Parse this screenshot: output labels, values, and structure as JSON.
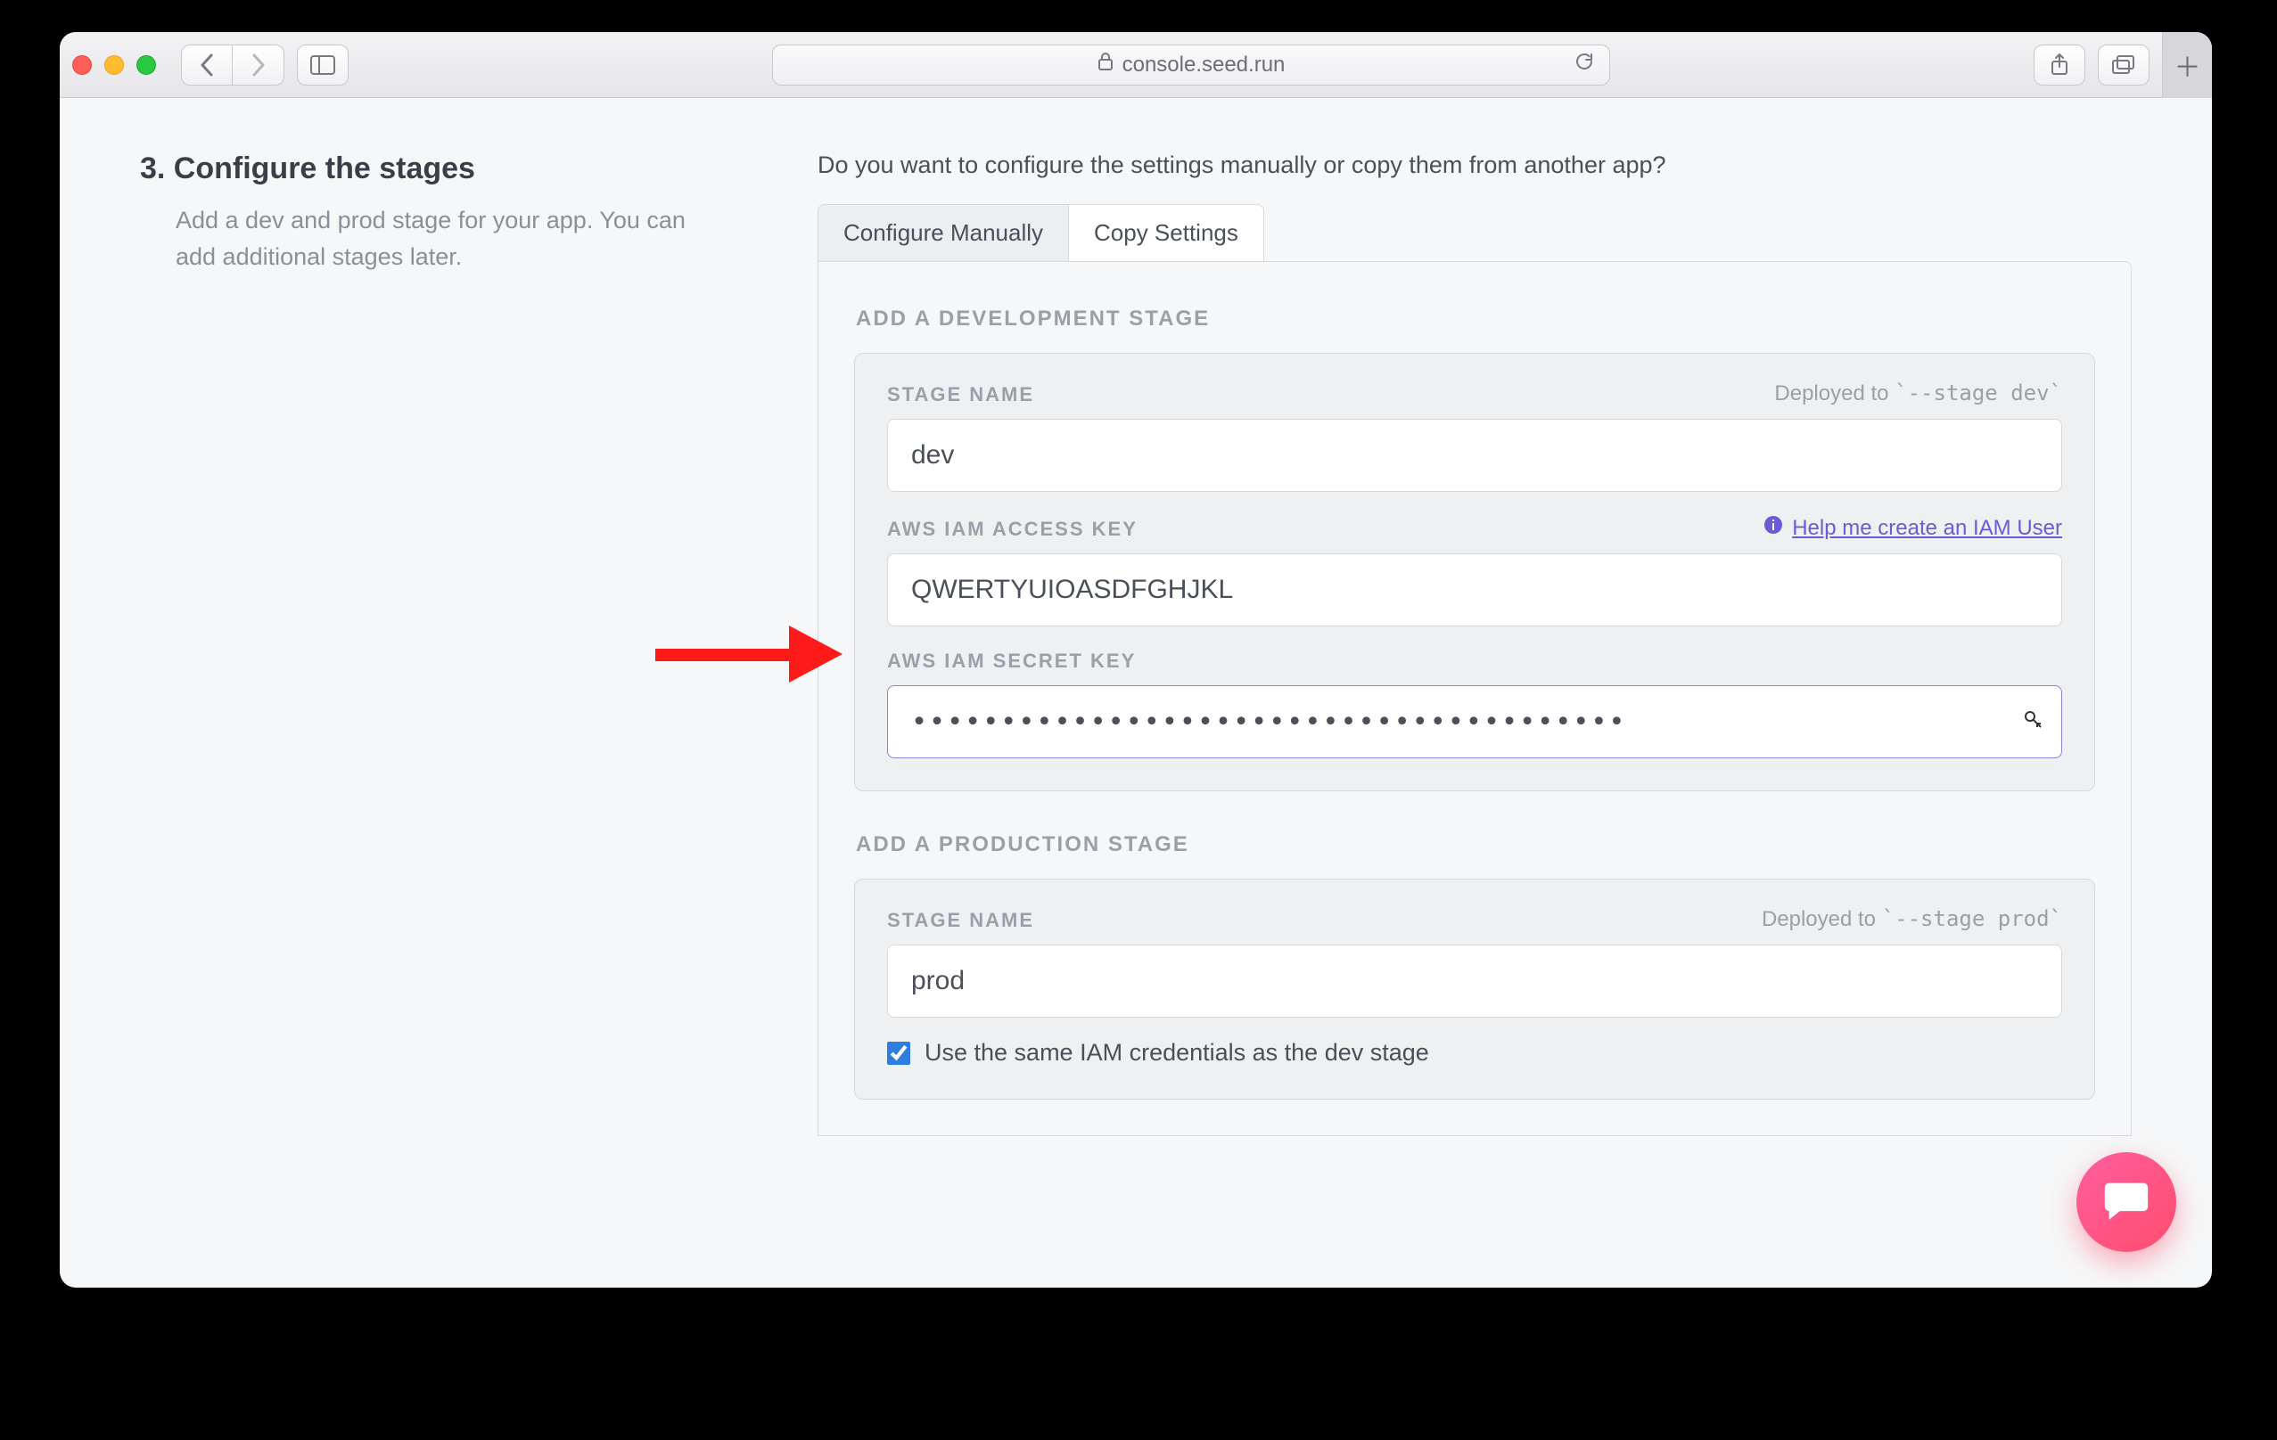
{
  "browser": {
    "url_host": "console.seed.run"
  },
  "step": {
    "title": "3. Configure the stages",
    "subtitle": "Add a dev and prod stage for your app. You can add additional stages later."
  },
  "prompt": "Do you want to configure the settings manually or copy them from another app?",
  "tabs": {
    "manual": "Configure Manually",
    "copy": "Copy Settings"
  },
  "dev_section": {
    "heading": "ADD A DEVELOPMENT STAGE",
    "stage_name_label": "STAGE NAME",
    "deployed_to_prefix": "Deployed to ",
    "deployed_to_code": "`--stage dev`",
    "stage_name_value": "dev",
    "access_key_label": "AWS IAM ACCESS KEY",
    "help_link": "Help me create an IAM User",
    "access_key_value": "QWERTYUIOASDFGHJKL",
    "secret_key_label": "AWS IAM SECRET KEY",
    "secret_key_value": "········································"
  },
  "prod_section": {
    "heading": "ADD A PRODUCTION STAGE",
    "stage_name_label": "STAGE NAME",
    "deployed_to_prefix": "Deployed to ",
    "deployed_to_code": "`--stage prod`",
    "stage_name_value": "prod",
    "same_iam_label": "Use the same IAM credentials as the dev stage"
  }
}
